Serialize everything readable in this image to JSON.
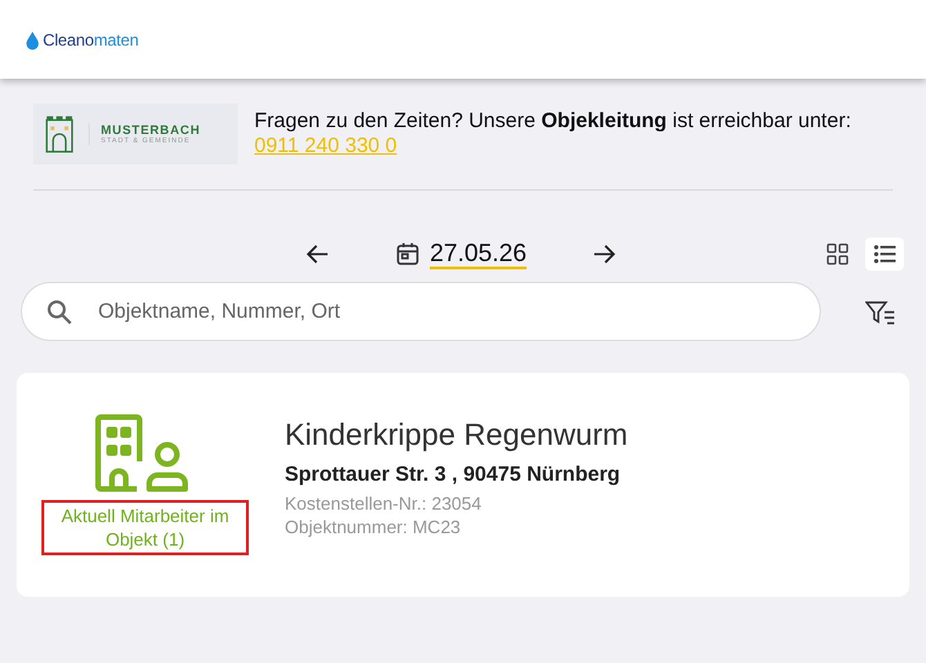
{
  "header": {
    "logo_parts": [
      "Cleano",
      "maten"
    ]
  },
  "banner": {
    "org_name": "MUSTERBACH",
    "org_subtitle": "STADT & GEMEINDE",
    "info": "Fragen zu den Zeiten? Unsere **Objekleitung** ist erreichbar unter:",
    "phone": "0911 240 330 0"
  },
  "date_nav": {
    "date": "27.05.26"
  },
  "views": [
    {
      "kind": "grid",
      "selected": false
    },
    {
      "kind": "list",
      "selected": true
    }
  ],
  "search": {
    "placeholder": "Objektname, Nummer, Ort"
  },
  "objects": [
    {
      "name": "Kinderkrippe Regenwurm",
      "address": "Sprottauer Str. 3 , 90475 Nürnberg",
      "cost_center": "Kostenstellen-Nr.: 23054",
      "object_number": "Objektnummer: MC23",
      "staff_status": "Aktuell Mitarbeiter im Objekt (1)",
      "highlighted": true
    }
  ]
}
